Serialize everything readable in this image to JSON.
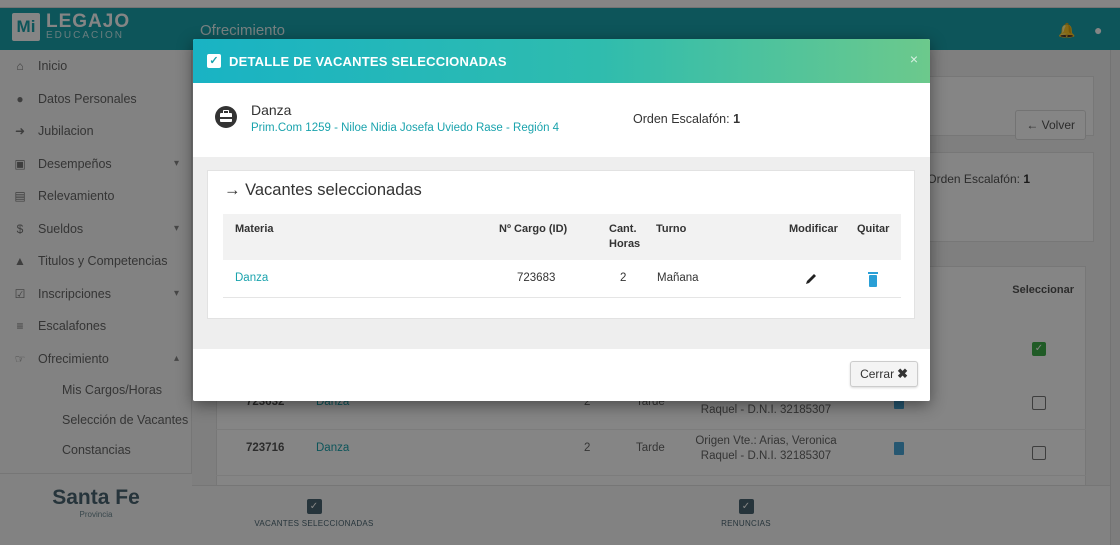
{
  "app": {
    "logo_mi": "Mi",
    "logo_name": "LEGAJO",
    "logo_sub": "EDUCACION",
    "page_title": "Ofrecimiento"
  },
  "sidebar": {
    "items": [
      {
        "label": "Inicio",
        "icon": "home-icon"
      },
      {
        "label": "Datos Personales",
        "icon": "user-icon"
      },
      {
        "label": "Jubilacion",
        "icon": "arrow-icon"
      },
      {
        "label": "Desempeños",
        "icon": "briefcase-icon"
      },
      {
        "label": "Relevamiento",
        "icon": "clipboard-icon"
      },
      {
        "label": "Sueldos",
        "icon": "dollar-icon"
      },
      {
        "label": "Titulos y Competencias",
        "icon": "graduation-icon"
      },
      {
        "label": "Inscripciones",
        "icon": "check-icon"
      },
      {
        "label": "Escalafones",
        "icon": "list-icon"
      },
      {
        "label": "Ofrecimiento",
        "icon": "hand-icon"
      }
    ],
    "subitems": [
      "Mis Cargos/Horas",
      "Selección de Vacantes",
      "Constancias"
    ],
    "brand_name": "Santa Fe",
    "brand_sub": "Provincia"
  },
  "background": {
    "volver_label": "← Volver",
    "orden_label": "Orden Escalafón:",
    "orden_value": "1",
    "seleccionar_header": "Seleccionar",
    "rows": [
      {
        "id": "723632",
        "materia": "Danza",
        "horas": "2",
        "turno": "Tarde",
        "docente": "Origen Vte.: Arias, Veronica Raquel - D.N.I. 32185307"
      },
      {
        "id": "723716",
        "materia": "Danza",
        "horas": "2",
        "turno": "Tarde",
        "docente": "Origen Vte.: Arias, Veronica Raquel - D.N.I. 32185307"
      }
    ]
  },
  "footer": {
    "tab1_label": "VACANTES SELECCIONADAS",
    "tab2_label": "RENUNCIAS"
  },
  "modal": {
    "title": "DETALLE DE VACANTES SELECCIONADAS",
    "close_symbol": "×",
    "materia_name": "Danza",
    "school": "Prim.Com 1259 - Niloe Nidia Josefa Uviedo Rase - Región 4",
    "orden_label": "Orden Escalafón:",
    "orden_value": "1",
    "section_title": "→ Vacantes seleccionadas",
    "columns": {
      "materia": "Materia",
      "cargo": "Nº Cargo (ID)",
      "horas_1": "Cant.",
      "horas_2": "Horas",
      "turno": "Turno",
      "modificar": "Modificar",
      "quitar": "Quitar"
    },
    "rows": [
      {
        "materia": "Danza",
        "cargo": "723683",
        "horas": "2",
        "turno": "Mañana"
      }
    ],
    "cerrar_label": "Cerrar",
    "cerrar_icon": "✖"
  },
  "colors": {
    "accent": "#1aa3ad",
    "header_gradient_start": "#19b3c4",
    "header_gradient_end": "#6cc98c",
    "trash_blue": "#2a9fd6"
  }
}
